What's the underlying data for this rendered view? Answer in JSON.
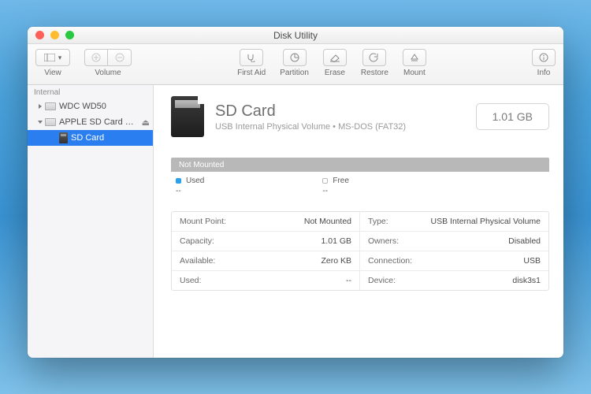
{
  "window": {
    "title": "Disk Utility"
  },
  "toolbar": {
    "view": "View",
    "volume": "Volume",
    "firstaid": "First Aid",
    "partition": "Partition",
    "erase": "Erase",
    "restore": "Restore",
    "mount": "Mount",
    "info": "Info"
  },
  "sidebar": {
    "section": "Internal",
    "items": [
      {
        "label": "WDC WD50"
      },
      {
        "label": "APPLE SD Card R…"
      },
      {
        "label": "SD Card"
      }
    ]
  },
  "volume": {
    "name": "SD Card",
    "subtitle": "USB Internal Physical Volume • MS-DOS (FAT32)",
    "capacity_display": "1.01 GB",
    "status_bar": "Not Mounted",
    "legend": {
      "used_label": "Used",
      "used_value": "--",
      "free_label": "Free",
      "free_value": "--"
    },
    "details": {
      "mount_point_k": "Mount Point:",
      "mount_point_v": "Not Mounted",
      "type_k": "Type:",
      "type_v": "USB Internal Physical Volume",
      "capacity_k": "Capacity:",
      "capacity_v": "1.01 GB",
      "owners_k": "Owners:",
      "owners_v": "Disabled",
      "available_k": "Available:",
      "available_v": "Zero KB",
      "connection_k": "Connection:",
      "connection_v": "USB",
      "used_k": "Used:",
      "used_v": "--",
      "device_k": "Device:",
      "device_v": "disk3s1"
    }
  }
}
